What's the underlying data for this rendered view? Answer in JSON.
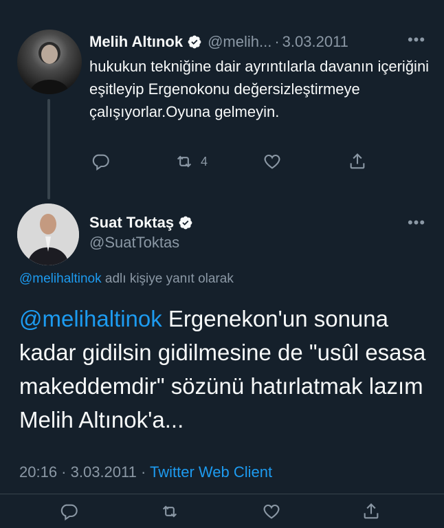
{
  "parent_tweet": {
    "author_name": "Melih Altınok",
    "handle": "@melih...",
    "separator": "·",
    "date": "3.03.2011",
    "more_label": "•••",
    "text": "hukukun tekniğine dair ayrıntılarla davanın içeriğini eşitleyip Ergenokonu değersizleştirmeye çalışıyorlar.Oyuna gelmeyin.",
    "retweet_count": "4",
    "verified": true
  },
  "main_tweet": {
    "author_name": "Suat Toktaş",
    "handle": "@SuatToktas",
    "more_label": "•••",
    "reply_to_mention": "@melihaltinok",
    "reply_to_suffix": " adlı kişiye yanıt olarak",
    "mention": "@melihaltinok",
    "text": " Ergenekon'un sonuna kadar gidilsin gidilmesine de \"usûl esasa makeddemdir\" sözünü hatırlatmak lazım Melih Altınok'a...",
    "time": "20:16",
    "separator": " · ",
    "date": "3.03.2011",
    "client": "Twitter Web Client",
    "verified": true
  },
  "colors": {
    "background": "#15202b",
    "text": "#f7f9f9",
    "secondary": "#8b98a5",
    "accent": "#1d9bf0",
    "border": "#38444d"
  },
  "icons": {
    "reply": "reply-icon",
    "retweet": "retweet-icon",
    "like": "like-icon",
    "share": "share-icon",
    "verified": "verified-badge-icon",
    "more": "more-icon"
  }
}
